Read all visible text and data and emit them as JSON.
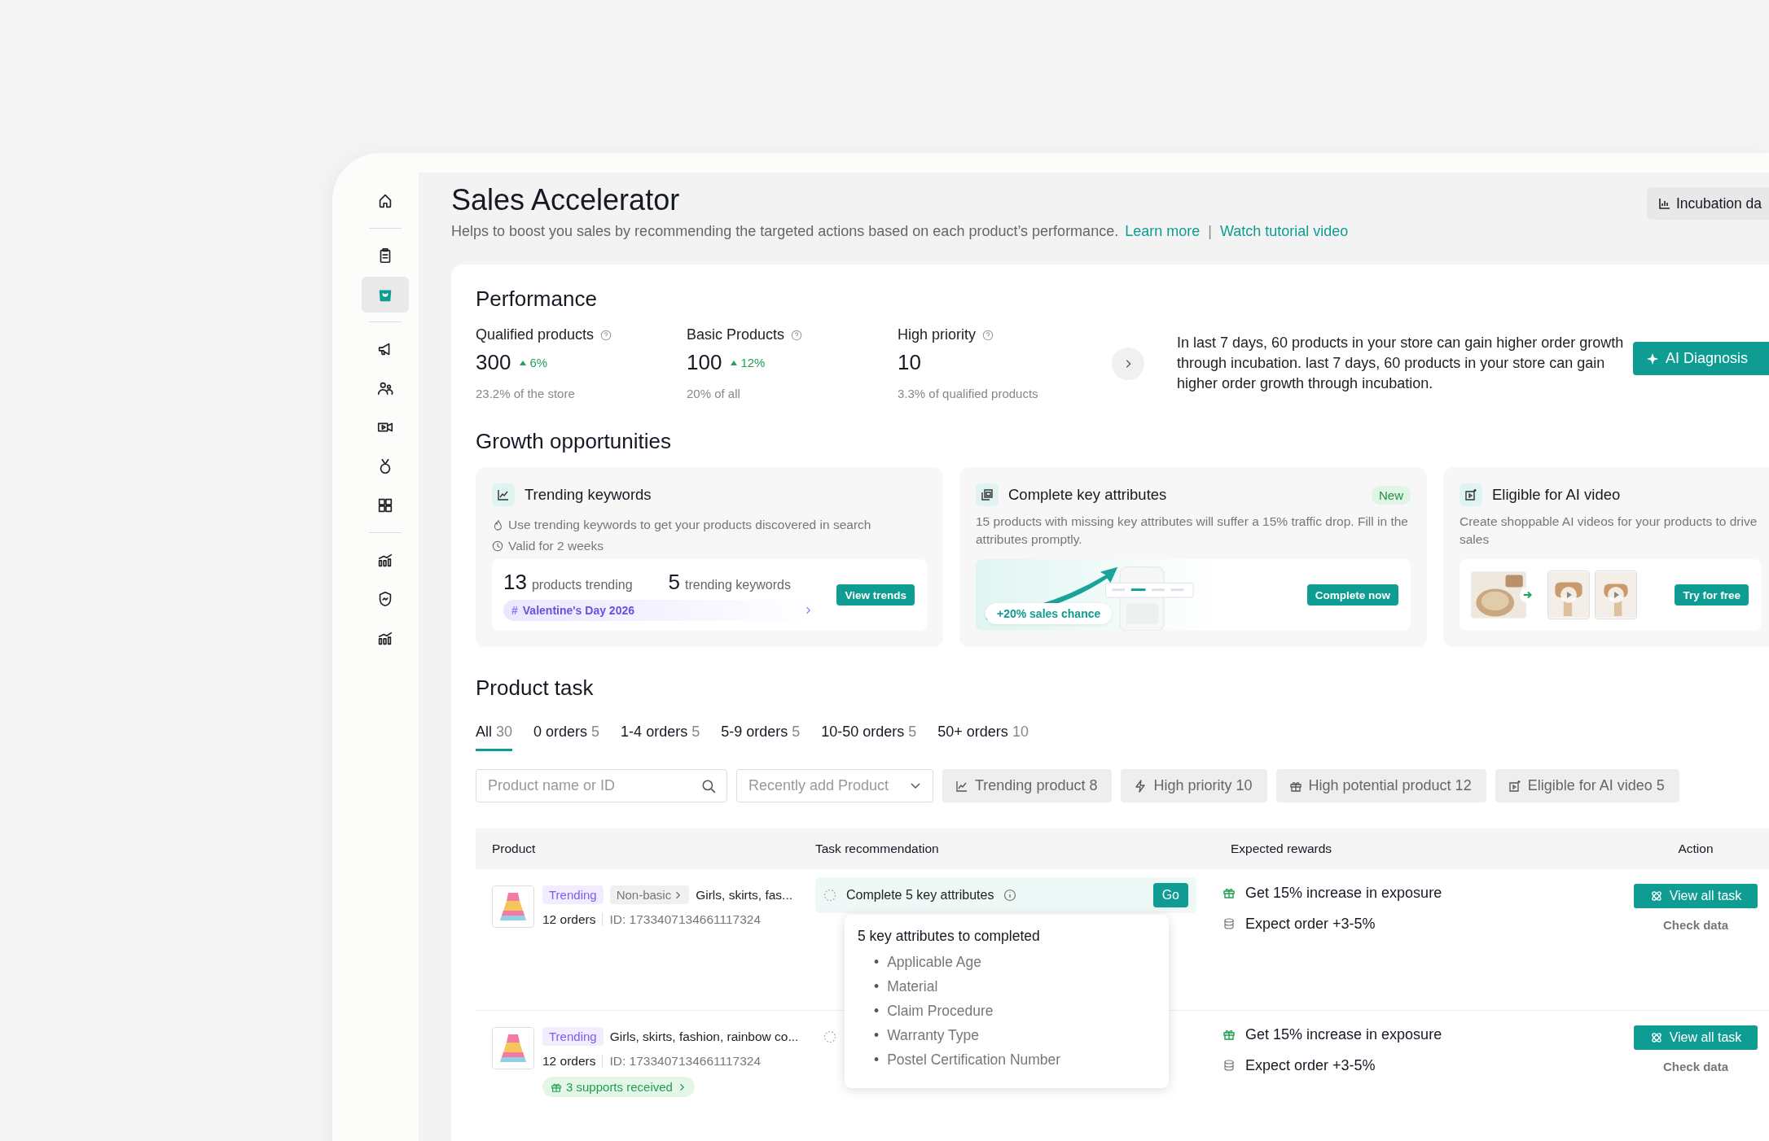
{
  "sidebar": {
    "groups": [
      {
        "items": [
          {
            "selected": false
          }
        ]
      },
      {
        "items": [
          {
            "selected": false
          },
          {
            "selected": true
          }
        ]
      },
      {
        "items": [
          {
            "selected": false
          },
          {
            "selected": false
          },
          {
            "selected": false
          },
          {
            "selected": false
          },
          {
            "selected": false
          }
        ]
      },
      {
        "items": [
          {
            "selected": false
          },
          {
            "selected": false
          },
          {
            "selected": false
          }
        ]
      }
    ]
  },
  "header": {
    "title": "Sales Accelerator",
    "subtitle": "Helps to boost you sales by recommending the targeted actions based on each product’s performance.",
    "links": [
      "Learn more",
      "Watch tutorial video"
    ],
    "separator": "|",
    "button": "Incubation da"
  },
  "performance": {
    "title": "Performance",
    "metrics": [
      {
        "label": "Qualified products",
        "value": "300",
        "change": "6%",
        "note": "23.2% of the store"
      },
      {
        "label": "Basic Products",
        "value": "100",
        "change": "12%",
        "note": "20% of all"
      },
      {
        "label": "High priority",
        "value": "10",
        "note": "3.3% of qualified products"
      }
    ],
    "summary": "In last 7 days, 60 products in your store can gain higher order growth through incubation. last 7 days, 60 products in your store can gain higher order growth through incubation.",
    "button": "AI Diagnosis"
  },
  "growth": {
    "title": "Growth opportunities",
    "cards": [
      {
        "kind": "keywords",
        "title": "Trending keywords",
        "notes": [
          "Use trending keywords to get your products discovered in search",
          "Valid for 2 weeks"
        ],
        "stats": [
          {
            "value": "13",
            "label": "products trending"
          },
          {
            "value": "5",
            "label": "trending keywords"
          }
        ],
        "tag_symbol": "#",
        "tag": "Valentine's Day 2026",
        "button": "View trends"
      },
      {
        "kind": "attributes",
        "title": "Complete key attributes",
        "badge": "New",
        "description": "15 products with missing key attributes will suffer a 15% traffic drop. Fill in the attributes promptly.",
        "chip": "+20% sales chance",
        "button": "Complete now"
      },
      {
        "kind": "ai_video",
        "title": "Eligible for AI video",
        "description": "Create shoppable AI videos for your products to drive sales",
        "button": "Try for free"
      }
    ]
  },
  "product_task": {
    "title": "Product task",
    "tabs": [
      {
        "label": "All",
        "count": "30",
        "selected": true
      },
      {
        "label": "0 orders",
        "count": "5",
        "selected": false
      },
      {
        "label": "1-4 orders",
        "count": "5",
        "selected": false
      },
      {
        "label": "5-9 orders",
        "count": "5",
        "selected": false
      },
      {
        "label": "10-50 orders",
        "count": "5",
        "selected": false
      },
      {
        "label": "50+ orders",
        "count": "10",
        "selected": false
      }
    ],
    "search": {
      "placeholder": "Product name or ID"
    },
    "sort": {
      "placeholder": "Recently add Product"
    },
    "filters": [
      "Trending product 8",
      "High priority 10",
      "High potential product 12",
      "Eligible for AI video 5"
    ],
    "table": {
      "columns": [
        "Product",
        "Task recommendation",
        "Expected rewards",
        "Action"
      ],
      "rows": [
        {
          "tags": [
            {
              "kind": "trend",
              "label": "Trending"
            },
            {
              "kind": "category",
              "label": "Non-basic"
            }
          ],
          "name": "Girls, skirts, fas...",
          "orders": "12 orders",
          "id": "ID: 1733407134661117324",
          "task": {
            "text": "Complete 5 key attributes",
            "button": "Go"
          },
          "rewards": [
            "Get 15% increase in exposure",
            "Expect order +3-5%"
          ],
          "button": "View all task",
          "link": "Check data"
        },
        {
          "tags": [
            {
              "kind": "trend",
              "label": "Trending"
            }
          ],
          "name": "Girls, skirts, fashion, rainbow co...",
          "orders": "12 orders",
          "id": "ID: 1733407134661117324",
          "support": "3 supports received",
          "rewards": [
            "Get 15% increase in exposure",
            "Expect order +3-5%"
          ],
          "button": "View all task",
          "link": "Check data"
        }
      ]
    },
    "tooltip": {
      "title": "5 key attributes to completed",
      "bullet": "•",
      "items": [
        "Applicable Age",
        "Material",
        "Claim Procedure",
        "Warranty Type",
        "Postel Certification Number"
      ]
    }
  }
}
